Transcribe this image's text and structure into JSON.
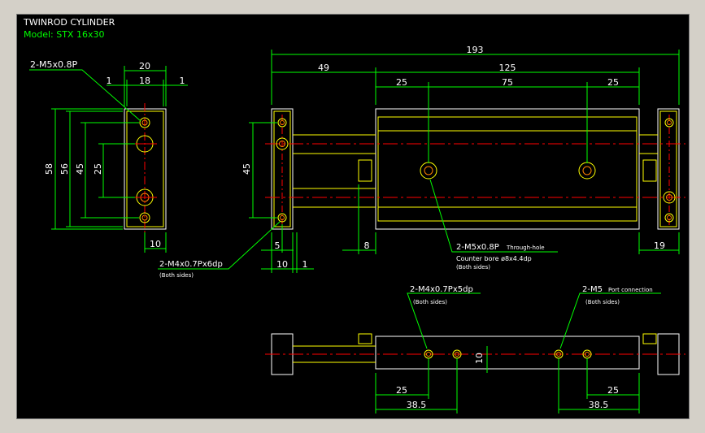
{
  "title": "TWINROD CYLINDER",
  "model": "Model: STX 16x30",
  "colors": {
    "background": "#000000",
    "outline": "#ffffff",
    "body": "#ffff00",
    "dimension": "#00ff00",
    "center": "#ff0000",
    "hole": "#ff8000",
    "label": "#ffffff"
  },
  "dims": {
    "d193": "193",
    "d49": "49",
    "d125": "125",
    "d25a": "25",
    "d75": "75",
    "d25b": "25",
    "d20": "20",
    "d18": "18",
    "d1a": "1",
    "d1b": "1",
    "d58": "58",
    "d56": "56",
    "d45a": "45",
    "d25v": "25",
    "d10a": "10",
    "d45b": "45",
    "d5": "5",
    "d8": "8",
    "d10b": "10",
    "d1c": "1",
    "d19": "19",
    "d10c": "10",
    "d25c": "25",
    "d385a": "38.5",
    "d25d": "25",
    "d385b": "38.5"
  },
  "callouts": {
    "m5": "2-M5x0.8P",
    "m4side": "2-M4x0.7Px6dp",
    "m4side_note": "(Both sides)",
    "thru_main": "2-M5x0.8P",
    "thru_suffix": "Through-hole",
    "counter": "Counter bore ø8x4.4dp",
    "thru_note": "(Both sides)",
    "m4bot": "2-M4x0.7Px5dp",
    "m4bot_note": "(Both sides)",
    "m5port": "2-M5",
    "m5port_suffix": "Port connection",
    "m5port_note": "(Both sides)"
  }
}
